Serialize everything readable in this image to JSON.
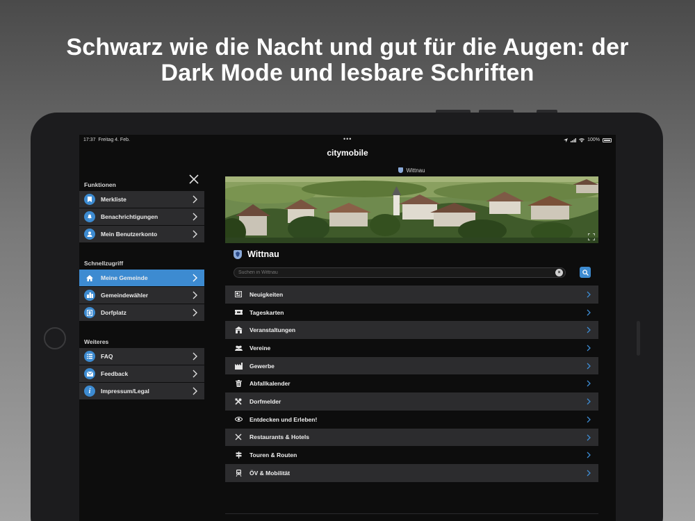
{
  "headline": {
    "line1": "Schwarz wie die Nacht und gut für die Augen: der",
    "line2": "Dark Mode und lesbare Schriften"
  },
  "statusbar": {
    "time": "17:37",
    "date": "Freitag 4. Feb.",
    "battery": "100%",
    "battery_level": 1.0
  },
  "app": {
    "title": "citymobile"
  },
  "sidebar": {
    "sections": [
      {
        "label": "Funktionen",
        "items": [
          {
            "label": "Merkliste",
            "icon": "bookmark-icon"
          },
          {
            "label": "Benachrichtigungen",
            "icon": "bell-icon"
          },
          {
            "label": "Mein Benutzerkonto",
            "icon": "user-icon"
          }
        ]
      },
      {
        "label": "Schnellzugriff",
        "items": [
          {
            "label": "Meine Gemeinde",
            "icon": "home-icon",
            "active": true
          },
          {
            "label": "Gemeindewähler",
            "icon": "city-icon"
          },
          {
            "label": "Dorfplatz",
            "icon": "film-icon"
          }
        ]
      },
      {
        "label": "Weiteres",
        "items": [
          {
            "label": "FAQ",
            "icon": "list-icon"
          },
          {
            "label": "Feedback",
            "icon": "mail-icon"
          },
          {
            "label": "Impressum/Legal",
            "icon": "info-icon"
          }
        ]
      }
    ]
  },
  "content": {
    "location": "Wittnau",
    "town_name": "Wittnau",
    "search_placeholder": "Suchen in Wittnau",
    "categories": [
      {
        "label": "Neuigkeiten",
        "icon": "news-icon"
      },
      {
        "label": "Tageskarten",
        "icon": "ticket-icon"
      },
      {
        "label": "Veranstaltungen",
        "icon": "venue-icon"
      },
      {
        "label": "Vereine",
        "icon": "group-icon"
      },
      {
        "label": "Gewerbe",
        "icon": "factory-icon"
      },
      {
        "label": "Abfallkalender",
        "icon": "trash-icon"
      },
      {
        "label": "Dorfmelder",
        "icon": "tools-icon"
      },
      {
        "label": "Entdecken und Erleben!",
        "icon": "eye-icon"
      },
      {
        "label": "Restaurants & Hotels",
        "icon": "cutlery-icon"
      },
      {
        "label": "Touren & Routen",
        "icon": "signpost-icon"
      },
      {
        "label": "ÖV & Mobilität",
        "icon": "train-icon"
      }
    ]
  },
  "colors": {
    "accent": "#3d8bd1",
    "row_dark": "#2c2c2e",
    "screen_bg": "#0d0d0d"
  }
}
